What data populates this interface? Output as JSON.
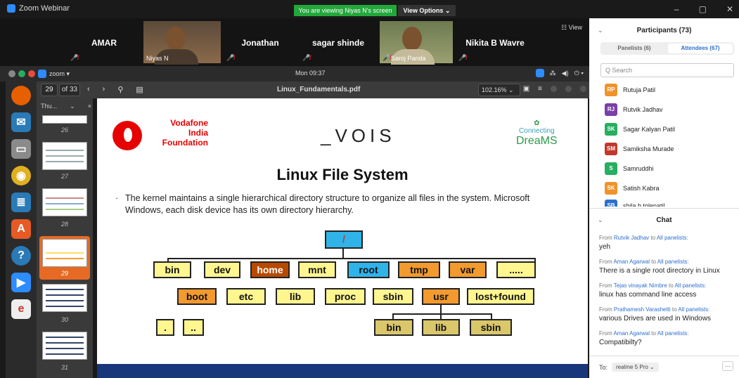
{
  "window": {
    "title": "Zoom Webinar",
    "viewing_banner": "You are viewing Niyas N's screen",
    "view_options": "View Options ⌄"
  },
  "videos": {
    "tiles": [
      {
        "name": "AMAR"
      },
      {
        "name": "Niyas N",
        "video": true
      },
      {
        "name": "Jonathan"
      },
      {
        "name": "sagar shinde"
      },
      {
        "name": "Saroj Panda",
        "video": true
      },
      {
        "name": "Nikita B Wavre"
      }
    ],
    "view_label": "☷ View"
  },
  "ubuntu": {
    "clock": "Mon 09:37",
    "app_label": "zoom ▾"
  },
  "pdf": {
    "page": "29",
    "of_pages": "of 33",
    "filename": "Linux_Fundamentals.pdf",
    "zoom": "102.16% ⌄",
    "thumb_header": "Thu...",
    "thumb_pages": [
      "26",
      "27",
      "28",
      "29",
      "30",
      "31"
    ]
  },
  "slide": {
    "vodafone": "Vodafone\nIndia\nFoundation",
    "vois": "_VOIS",
    "cd_top": "Connecting",
    "cd_bottom": "DreaMS",
    "title": "Linux File System",
    "text": "The kernel maintains a single hierarchical directory structure to organize all files in the system. Microsoft Windows, each disk device has its own directory hierarchy.",
    "root": "/",
    "row1": [
      "bin",
      "dev",
      "home",
      "mnt",
      "root",
      "tmp",
      "var",
      "....."
    ],
    "row2": [
      "boot",
      "etc",
      "lib",
      "proc",
      "sbin",
      "usr",
      "lost+found"
    ],
    "row3_left": [
      ".",
      ".."
    ],
    "row3_right": [
      "bin",
      "lib",
      "sbin"
    ]
  },
  "participants": {
    "header": "Participants (73)",
    "tab_panelists": "Panelists (6)",
    "tab_attendees": "Attendees (67)",
    "search_placeholder": "Q Search",
    "list": [
      {
        "initials": "RP",
        "name": "Rutuja Patil",
        "color": "#f0932b"
      },
      {
        "initials": "RJ",
        "name": "Rutvik Jadhav",
        "color": "#7b3fa8"
      },
      {
        "initials": "SK",
        "name": "Sagar Kalyan Patil",
        "color": "#27ae60"
      },
      {
        "initials": "SM",
        "name": "Samiksha Murade",
        "color": "#c0392b"
      },
      {
        "initials": "S",
        "name": "Samruddhi",
        "color": "#27ae60"
      },
      {
        "initials": "SK",
        "name": "Satish Kabra",
        "color": "#f0932b"
      },
      {
        "initials": "SB",
        "name": "shila b tolenatil",
        "color": "#2d6fd0"
      }
    ]
  },
  "chat": {
    "header": "Chat",
    "messages": [
      {
        "from": "Rutvik Jadhav",
        "to": "All panelists",
        "text": "yeh"
      },
      {
        "from": "Aman Agarwal",
        "to": "All panelists",
        "text": "There is a single root directory in Linux"
      },
      {
        "from": "Tejas vinayak Nimbre",
        "to": "All panelists",
        "text": "linux has command line access"
      },
      {
        "from": "Prathamesh Varashetti",
        "to": "All panelists",
        "text": "various Drives are used in Windows"
      },
      {
        "from": "Aman Agarwal",
        "to": "All panelists",
        "text": "Compatibilty?"
      }
    ],
    "from_word": "From",
    "to_word": "to",
    "to_label": "To:",
    "to_value": "realme 5 Pro ⌄",
    "more": "..."
  }
}
